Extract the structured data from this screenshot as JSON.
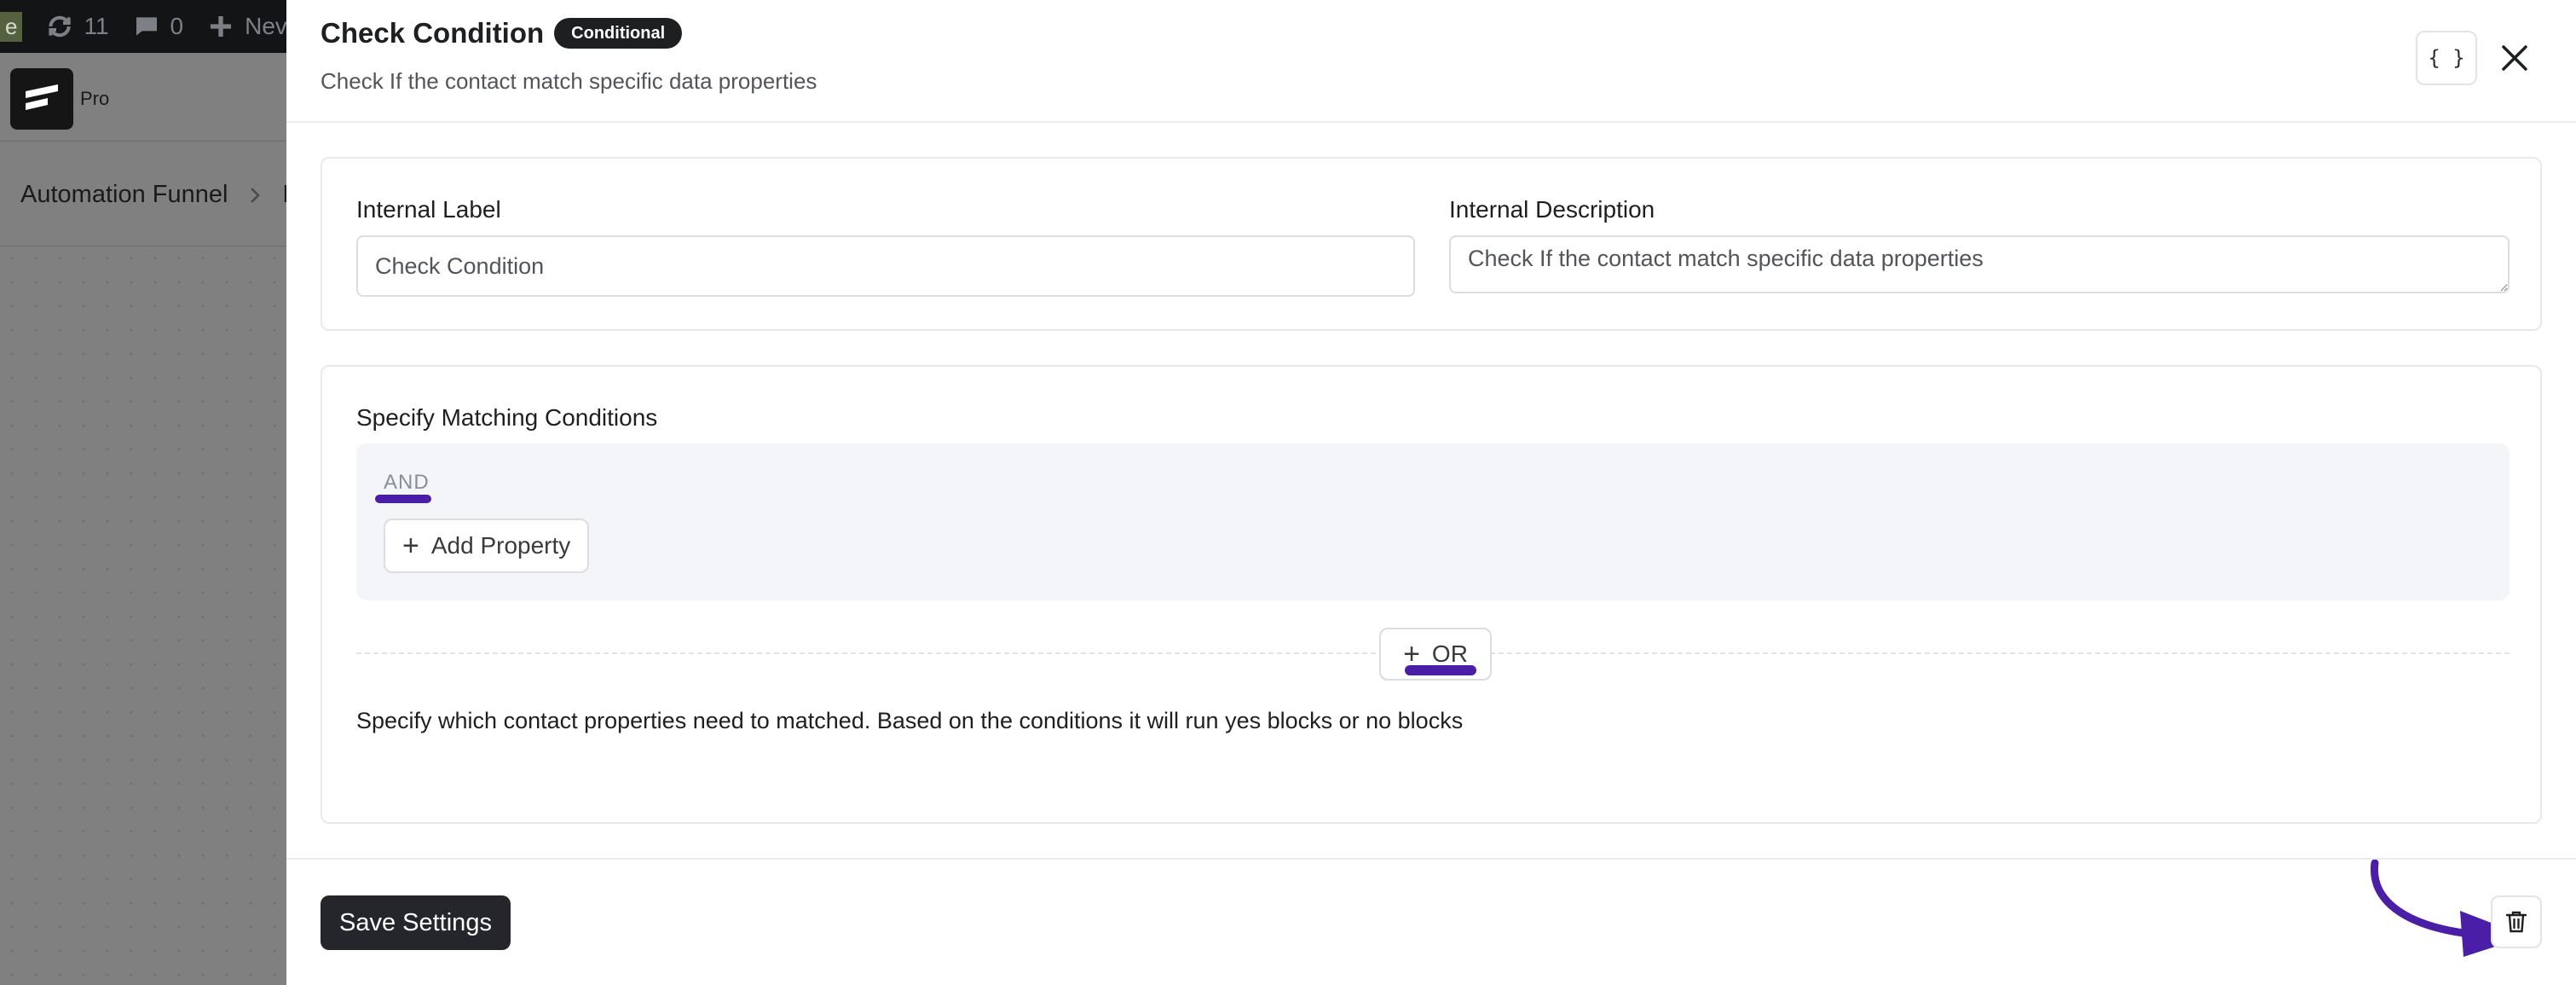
{
  "background": {
    "admin_bar": {
      "site_label": "e",
      "updates_count": "11",
      "comments_count": "0",
      "new_label": "Nev"
    },
    "pro_label": "Pro",
    "breadcrumb": {
      "first": "Automation Funnel",
      "second": "N"
    }
  },
  "drawer": {
    "title": "Check Condition",
    "badge": "Conditional",
    "subtitle": "Check If the contact match specific data properties",
    "code_button_label": "{ }",
    "fields": {
      "internal_label": {
        "label": "Internal Label",
        "value": "Check Condition"
      },
      "internal_description": {
        "label": "Internal Description",
        "value": "Check If the contact match specific data properties"
      }
    },
    "conditions": {
      "title": "Specify Matching Conditions",
      "group_operator": "AND",
      "add_property_label": "Add Property",
      "or_button_label": "OR",
      "help_text": "Specify which contact properties need to matched. Based on the conditions it will run yes blocks or no blocks"
    },
    "footer": {
      "save_label": "Save Settings"
    }
  },
  "colors": {
    "accent_annotation": "#4a1ea6",
    "primary_button": "#24262b",
    "badge": "#1e1f21"
  },
  "icons": [
    "sync-icon",
    "comment-icon",
    "plus-icon",
    "logo-icon",
    "chevron-right-icon",
    "close-icon",
    "code-icon",
    "trash-icon",
    "annotation-arrow-icon"
  ]
}
